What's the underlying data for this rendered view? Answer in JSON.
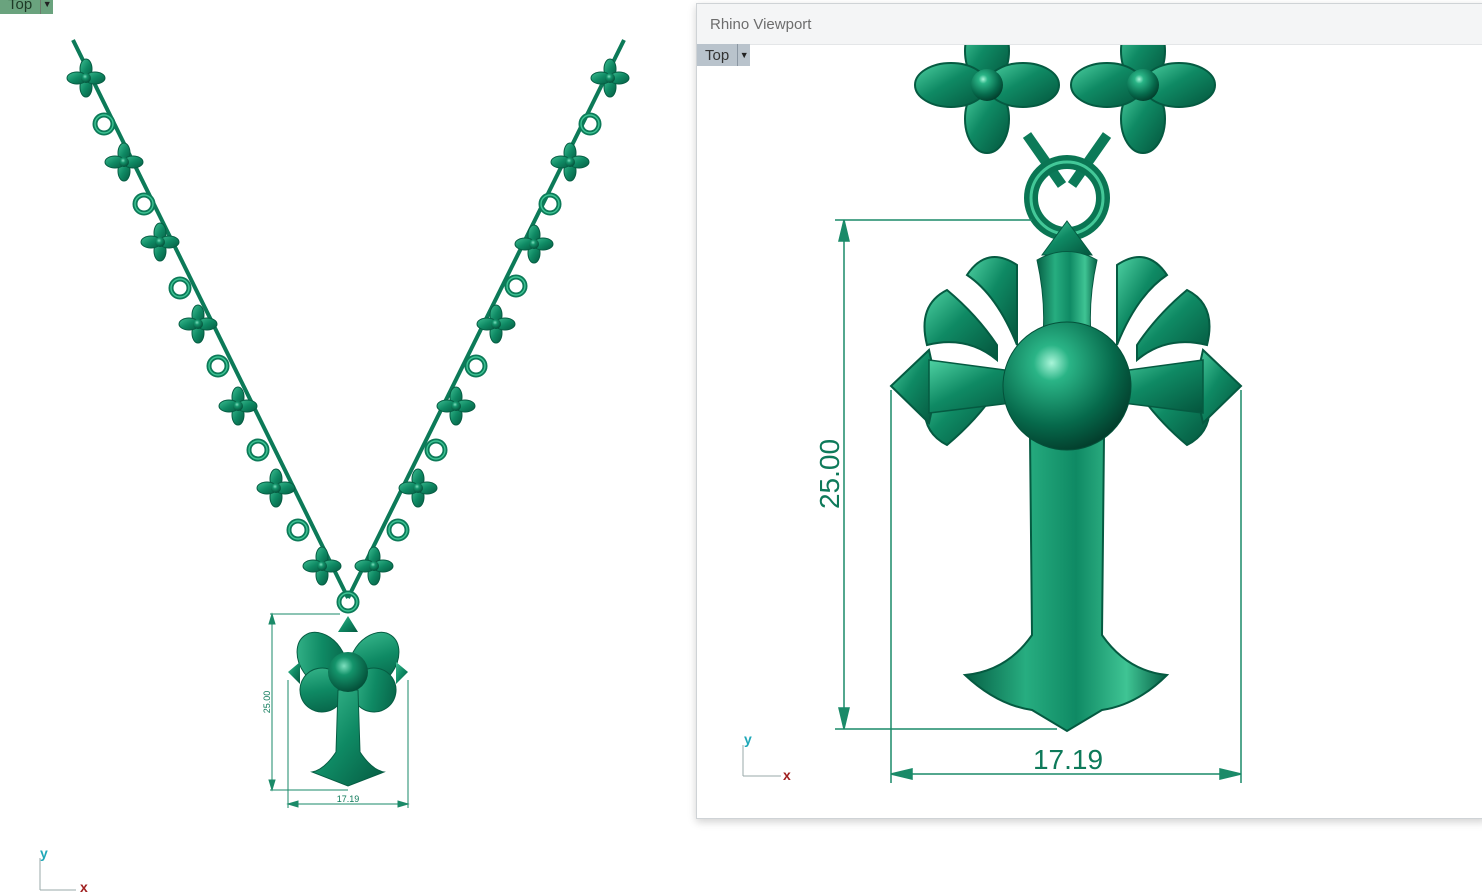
{
  "main_viewport": {
    "label": "Top",
    "dimension_height": "25.00",
    "dimension_width": "17.19",
    "axis_y": "y",
    "axis_x": "x"
  },
  "floating_viewport": {
    "window_title": "Rhino Viewport",
    "label": "Top",
    "dimension_height": "25.00",
    "dimension_width": "17.19",
    "axis_y": "y",
    "axis_x": "x"
  },
  "colors": {
    "model_green": "#0f8a64",
    "model_dark": "#066045",
    "dimension_line": "#1a8a68",
    "axis_y": "#1fa8b8",
    "axis_x": "#a02020"
  },
  "icons": {
    "viewport_menu": "chevron-down-icon",
    "axis_widget": "xy-axis-icon"
  }
}
